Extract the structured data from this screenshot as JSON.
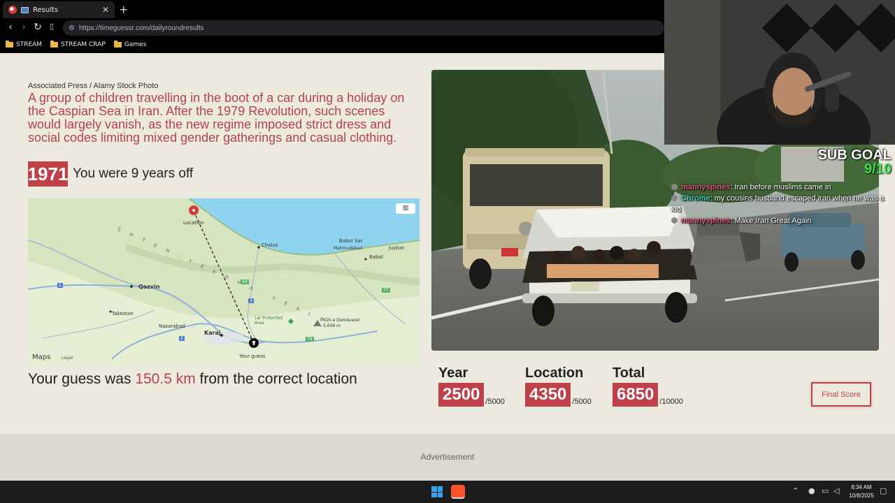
{
  "browser": {
    "tab_title": "Results",
    "new_tab": "+",
    "close": "✕",
    "url": "https://timeguessr.com/dailyroundresults",
    "bookmarks": [
      "STREAM",
      "STREAM CRAP",
      "Games"
    ]
  },
  "result": {
    "credit": "Associated Press / Alamy Stock Photo",
    "description": "A group of children travelling in the boot of a car during a holiday on the Caspian Sea in Iran. After the 1979 Revolution, such scenes would largely vanish, as the new regime imposed strict dress and social codes limiting mixed gender gatherings and casual clothing.",
    "year": "1971",
    "years_off": "You were 9 years off",
    "distance_prefix": "Your guess was ",
    "distance_value": "150.5 km",
    "distance_suffix": " from the correct location"
  },
  "map": {
    "labels": {
      "location": "Location",
      "your_guess": "Your guess",
      "chalus": "Chalus",
      "babol_sar": "Babol Sar",
      "mahmudabad": "Mahmudabad",
      "juybar": "Juybar",
      "babol": "Babol",
      "qazvin": "Qazvin",
      "takestan": "Takestan",
      "nazarabad": "Nazarabad",
      "karaj": "Karaj",
      "protected_area": "Lar Protected Area",
      "damavand": "Kūh-e Damāvand",
      "damavand_height": "5,609 m",
      "ridge": "S H T E H - Y E   K H H A - Y E   A L B",
      "maps": "Maps",
      "legal": "Legal",
      "routes": [
        "2",
        "3",
        "2",
        "59",
        "77",
        "79"
      ]
    }
  },
  "scores": {
    "year": {
      "label": "Year",
      "value": "2500",
      "max": "/5000"
    },
    "location": {
      "label": "Location",
      "value": "4350",
      "max": "/5000"
    },
    "total": {
      "label": "Total",
      "value": "6850",
      "max": "/10000"
    },
    "final_button": "Final Score"
  },
  "ad": {
    "label": "Advertisement"
  },
  "overlay": {
    "sub_goal_title": "SUB GOAL",
    "sub_goal_count": "9/10",
    "chat": [
      {
        "user": "mannyspines",
        "user_color": "#e0557a",
        "text": ": Iran before muslims came in"
      },
      {
        "user": "Chrome",
        "user_color": "#3fd0c0",
        "text": ": my cousins husband escaped iran when he was a kid"
      },
      {
        "user": "mannyspines",
        "user_color": "#e0557a",
        "text": ": Make Iran Great Again"
      }
    ]
  },
  "taskbar": {
    "time": "8:34 AM",
    "date": "10/8/2025"
  },
  "colors": {
    "accent": "#c0404a",
    "page_bg": "#ece9de",
    "sub_goal_green": "#3fe04a"
  }
}
